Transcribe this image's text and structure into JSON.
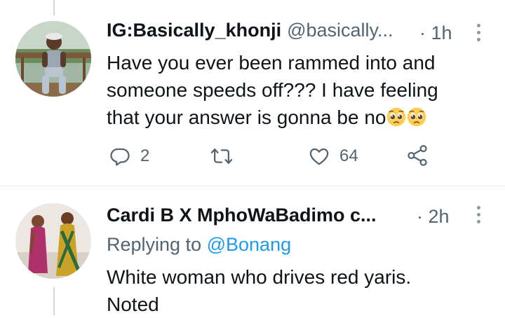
{
  "tweets": [
    {
      "display_name": "IG:Basically_khonji",
      "handle": "@basically...",
      "time": "· 1h",
      "text_lines": [
        "Have you ever been rammed into and",
        "someone speeds off??? I have feeling",
        "that your answer is gonna be no"
      ],
      "emojis": [
        "pleading-face",
        "pleading-face"
      ],
      "actions": {
        "replies": "2",
        "retweets": "",
        "likes": "64"
      }
    },
    {
      "display_name": "Cardi B X MphoWaBadimo c...",
      "time": "· 2h",
      "replying_prefix": "Replying to",
      "replying_to": "@Bonang",
      "text_lines": [
        "White woman who drives red yaris.",
        "Noted"
      ]
    }
  ],
  "colors": {
    "link": "#1d9bf0",
    "secondary": "#536471",
    "divider": "#e6ecf0"
  },
  "icons": [
    "reply-icon",
    "retweet-icon",
    "like-icon",
    "share-icon",
    "more-icon"
  ]
}
